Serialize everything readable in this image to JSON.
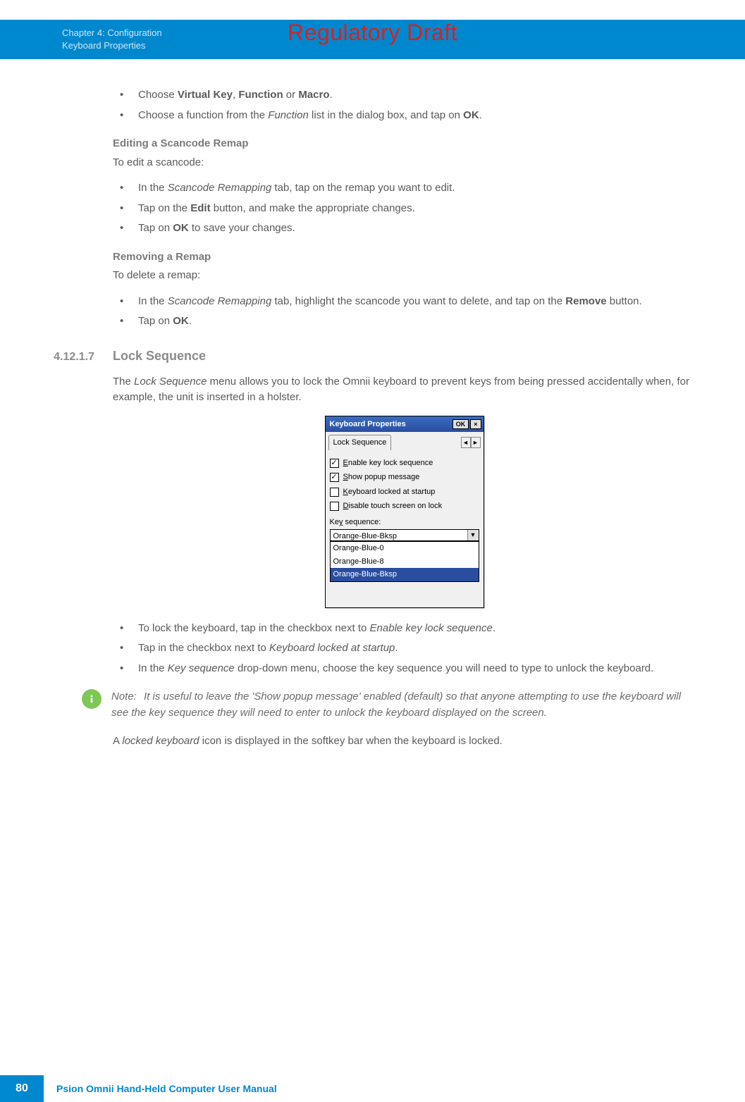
{
  "watermark": "Regulatory Draft",
  "header": {
    "chapter": "Chapter 4:  Configuration",
    "section": "Keyboard Properties"
  },
  "bullets_top": [
    {
      "pre": "Choose ",
      "b1": "Virtual Key",
      "mid1": ", ",
      "b2": "Function",
      "mid2": " or ",
      "b3": "Macro",
      "post": "."
    },
    {
      "pre": "Choose a function from the ",
      "i1": "Function",
      "mid1": " list in the dialog box, and tap on ",
      "b1": "OK",
      "post": "."
    }
  ],
  "edit_heading": "Editing a Scancode Remap",
  "edit_intro": "To edit a scancode:",
  "edit_bullets": [
    {
      "pre": "In the ",
      "i1": "Scancode Remapping",
      "mid1": " tab, tap on the remap you want to edit."
    },
    {
      "pre": "Tap on the ",
      "b1": "Edit",
      "mid1": " button, and make the appropriate changes."
    },
    {
      "pre": "Tap on ",
      "b1": "OK",
      "mid1": " to save your changes."
    }
  ],
  "remove_heading": "Removing a Remap",
  "remove_intro": "To delete a remap:",
  "remove_bullets": [
    {
      "pre": "In the ",
      "i1": "Scancode Remapping",
      "mid1": " tab, highlight the scancode you want to delete, and tap on the ",
      "b1": "Remove",
      "post": " button."
    },
    {
      "pre": "Tap on ",
      "b1": "OK",
      "post": "."
    }
  ],
  "section_num": "4.12.1.7",
  "section_title": "Lock Sequence",
  "lock_para_pre": "The ",
  "lock_para_i": "Lock Sequence",
  "lock_para_post": " menu allows you to lock the Omnii keyboard to prevent keys from being pressed accidentally when, for example, the unit is inserted in a holster.",
  "dialog": {
    "title": "Keyboard Properties",
    "ok": "OK",
    "close": "×",
    "tab": "Lock Sequence",
    "arrows": {
      "left": "◄",
      "right": "►"
    },
    "checks": [
      {
        "checked": true,
        "u": "E",
        "label": "nable key lock sequence"
      },
      {
        "checked": true,
        "u": "S",
        "label": "how popup message"
      },
      {
        "checked": false,
        "u": "K",
        "label": "eyboard locked at startup"
      },
      {
        "checked": false,
        "u": "D",
        "label": "isable touch screen on lock"
      }
    ],
    "seq_label_pre": "Ke",
    "seq_label_u": "y",
    "seq_label_post": " sequence:",
    "selected": "Orange-Blue-Bksp",
    "options": [
      "Orange-Blue-0",
      "Orange-Blue-8",
      "Orange-Blue-Bksp"
    ],
    "dropdown_arrow": "▼"
  },
  "lock_bullets": [
    {
      "pre": "To lock the keyboard, tap in the checkbox next to ",
      "i1": "Enable key lock sequence",
      "post": "."
    },
    {
      "pre": "Tap in the checkbox next to ",
      "i1": "Keyboard locked at startup",
      "post": "."
    },
    {
      "pre": "In the ",
      "i1": "Key sequence",
      "mid1": " drop-down menu, choose the key sequence you will need to type to unlock the keyboard."
    }
  ],
  "note_label": "Note:",
  "note_text": "It is useful to leave the 'Show popup message' enabled (default) so that anyone attempting to use the keyboard will see the key sequence they will need to enter to unlock the keyboard displayed on the screen.",
  "final_para_pre": "A ",
  "final_para_i": "locked keyboard",
  "final_para_post": " icon is displayed in the softkey bar when the keyboard is locked.",
  "footer": {
    "page": "80",
    "manual": "Psion Omnii Hand-Held Computer User Manual"
  }
}
